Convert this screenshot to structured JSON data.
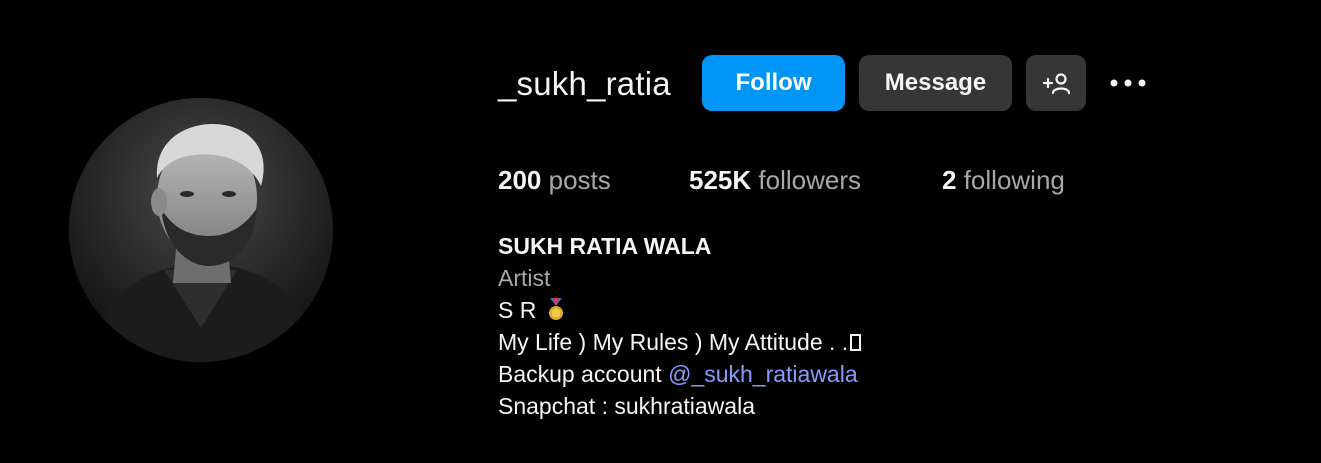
{
  "profile": {
    "username": "_sukh_ratia",
    "full_name": "SUKH RATIA WALA",
    "category": "Artist",
    "avatar_icon": "profile-photo"
  },
  "actions": {
    "follow_label": "Follow",
    "message_label": "Message",
    "suggest_icon": "add-person-icon",
    "more_icon": "more-options-icon"
  },
  "stats": {
    "posts_count": "200",
    "posts_label": "posts",
    "followers_count": "525K",
    "followers_label": "followers",
    "following_count": "2",
    "following_label": "following"
  },
  "bio": {
    "line1": "S R",
    "line1_emoji": "medal-icon",
    "line2": "My Life ) My Rules ) My Attitude . .",
    "line3_prefix": "Backup account ",
    "line3_mention": "@_sukh_ratiawala",
    "line4": "Snapchat : sukhratiawala"
  },
  "colors": {
    "background": "#000000",
    "follow_button": "#0095f6",
    "secondary_button": "#363636",
    "mention": "#8a9bff",
    "secondary_text": "#a8a8a8"
  }
}
